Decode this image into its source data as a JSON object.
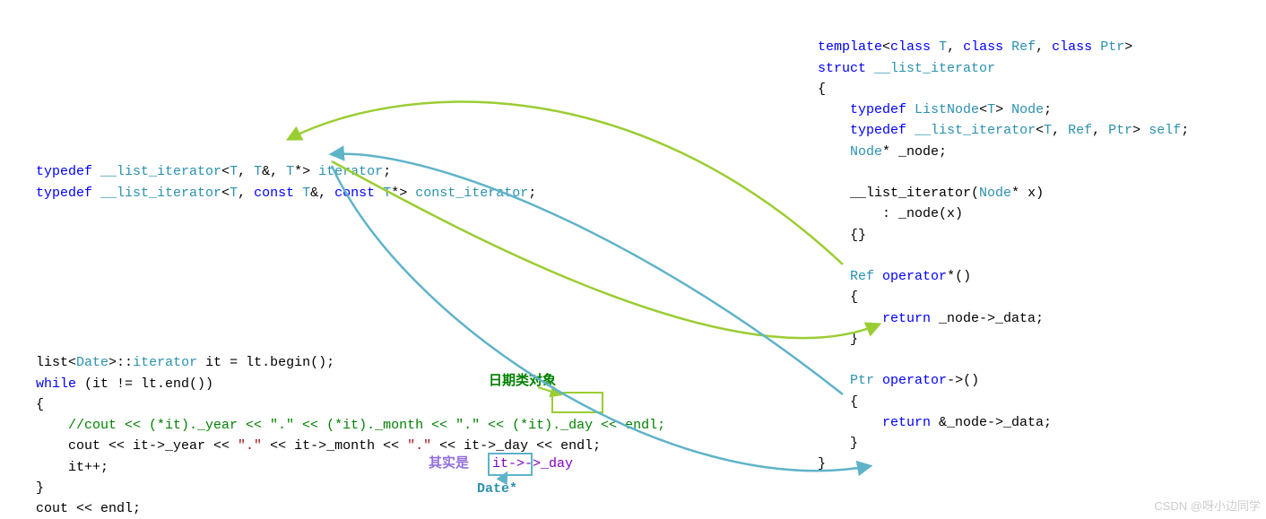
{
  "typedef_block": {
    "line1": {
      "typedef": "typedef",
      "iter": "__list_iterator",
      "lt": "<",
      "T1": "T",
      "c1": ", ",
      "T2": "T",
      "amp": "&, ",
      "T3": "T",
      "star": "*> ",
      "name": "iterator",
      "semi": ";"
    },
    "line2": {
      "typedef": "typedef",
      "iter": "__list_iterator",
      "lt": "<",
      "T1": "T",
      "c1": ", ",
      "const1": "const",
      "sp1": " ",
      "T2": "T",
      "amp": "&, ",
      "const2": "const",
      "sp2": " ",
      "T3": "T",
      "star": "*> ",
      "name": "const_iterator",
      "semi": ";"
    }
  },
  "bottom_block": {
    "line1": {
      "a": "list",
      "b": "<",
      "c": "Date",
      "d": ">::",
      "e": "iterator",
      "f": " it = lt.begin();"
    },
    "line2": {
      "a": "while",
      "b": " (it != lt.end())"
    },
    "line3": "{",
    "line4_comment": "//cout << (*it)._year << \".\" << (*it)._month << \".\" << (*it)._day << endl;",
    "line5": {
      "a": "cout << it->_year << ",
      "q1": "\".\"",
      "b": " << it->_month << ",
      "q2": "\".\"",
      "c": " << it->_day << endl;"
    },
    "line6": "it++;",
    "line7": "}",
    "line8": "cout << endl;"
  },
  "right_block": {
    "l1": {
      "a": "template",
      "b": "<",
      "c": "class",
      "d": " ",
      "e": "T",
      "f": ", ",
      "g": "class",
      "h": " ",
      "i": "Ref",
      "j": ", ",
      "k": "class",
      "l": " ",
      "m": "Ptr",
      "n": ">"
    },
    "l2": {
      "a": "struct",
      "b": " ",
      "c": "__list_iterator"
    },
    "l3": "{",
    "l4": {
      "a": "typedef",
      "b": " ",
      "c": "ListNode",
      "d": "<",
      "e": "T",
      "f": "> ",
      "g": "Node",
      "h": ";"
    },
    "l5": {
      "a": "typedef",
      "b": " ",
      "c": "__list_iterator",
      "d": "<",
      "e": "T",
      "f": ", ",
      "g": "Ref",
      "h": ", ",
      "i": "Ptr",
      "j": "> ",
      "k": "self",
      "l": ";"
    },
    "l6": {
      "a": "Node",
      "b": "* _node;"
    },
    "l7": {
      "a": "__list_iterator(",
      "b": "Node",
      "c": "* x)"
    },
    "l8": ": _node(x)",
    "l9": "{}",
    "l10": {
      "a": "Ref",
      "b": " ",
      "c": "operator",
      "d": "*()"
    },
    "l11": "{",
    "l12": {
      "a": "return",
      "b": " _node->_data;"
    },
    "l13": "}",
    "l14": {
      "a": "Ptr",
      "b": " ",
      "c": "operator",
      "d": "->()"
    },
    "l15": "{",
    "l16": {
      "a": "return",
      "b": " &_node->_data;"
    },
    "l17": "}",
    "l18": "}"
  },
  "annotations": {
    "date_obj": "日期类对象",
    "actually": "其实是",
    "it_arrow": "it->",
    "arrow_day": "->_day",
    "date_star": "Date*"
  },
  "watermark": "CSDN @呀小边同学"
}
